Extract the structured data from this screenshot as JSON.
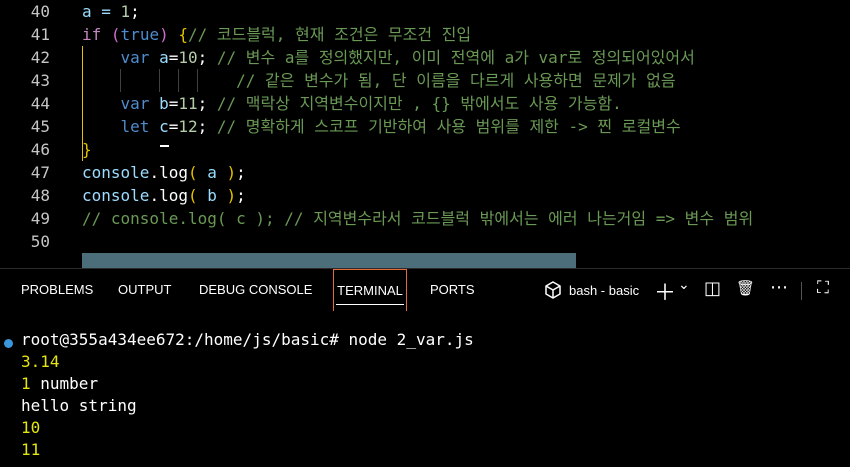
{
  "editor": {
    "lines": [
      {
        "num": "40",
        "parts": [
          {
            "t": "a = ",
            "c": "ident"
          },
          {
            "t": "1",
            "c": "num"
          },
          {
            "t": ";",
            "c": "plain"
          }
        ]
      },
      {
        "num": "41",
        "parts": [
          {
            "t": "if ",
            "c": "kw2"
          },
          {
            "t": "(",
            "c": "paren"
          },
          {
            "t": "true",
            "c": "bool"
          },
          {
            "t": ")",
            "c": "paren"
          },
          {
            "t": " {",
            "c": "brace"
          },
          {
            "t": "// 코드블럭, 현재 조건은 무조건 진입",
            "c": "cm"
          }
        ]
      },
      {
        "num": "42",
        "parts": [
          {
            "t": "    var ",
            "c": "kw"
          },
          {
            "t": "a",
            "c": "var"
          },
          {
            "t": "=",
            "c": "plain"
          },
          {
            "t": "10",
            "c": "num"
          },
          {
            "t": "; ",
            "c": "plain"
          },
          {
            "t": "// 변수 a를 정의했지만, 이미 전역에 a가 var로 정의되어있어서",
            "c": "cm"
          }
        ]
      },
      {
        "num": "43",
        "parts": [
          {
            "t": "                ",
            "c": "plain"
          },
          {
            "t": "// 같은 변수가 됨, 단 이름을 다르게 사용하면 문제가 없음",
            "c": "cm"
          }
        ]
      },
      {
        "num": "44",
        "parts": [
          {
            "t": "    var ",
            "c": "kw"
          },
          {
            "t": "b",
            "c": "var"
          },
          {
            "t": "=",
            "c": "plain"
          },
          {
            "t": "11",
            "c": "num"
          },
          {
            "t": "; ",
            "c": "plain"
          },
          {
            "t": "// 맥락상 지역변수이지만 , {} 밖에서도 사용 가능함.",
            "c": "cm"
          }
        ]
      },
      {
        "num": "45",
        "parts": [
          {
            "t": "    let ",
            "c": "kw"
          },
          {
            "t": "c",
            "c": "var"
          },
          {
            "t": "=",
            "c": "plain"
          },
          {
            "t": "12",
            "c": "num"
          },
          {
            "t": "; ",
            "c": "plain"
          },
          {
            "t": "// 명확하게 스코프 기반하여 사용 범위를 제한 -> 찐 로컬변수",
            "c": "cm"
          }
        ]
      },
      {
        "num": "46",
        "parts": [
          {
            "t": "}",
            "c": "brace"
          }
        ]
      },
      {
        "num": "47",
        "parts": [
          {
            "t": "console",
            "c": "ident"
          },
          {
            "t": ".",
            "c": "plain"
          },
          {
            "t": "log",
            "c": "plain"
          },
          {
            "t": "(",
            "c": "brace"
          },
          {
            "t": " a ",
            "c": "ident"
          },
          {
            "t": ")",
            "c": "brace"
          },
          {
            "t": ";",
            "c": "plain"
          }
        ]
      },
      {
        "num": "48",
        "parts": [
          {
            "t": "console",
            "c": "ident"
          },
          {
            "t": ".",
            "c": "plain"
          },
          {
            "t": "log",
            "c": "plain"
          },
          {
            "t": "(",
            "c": "brace"
          },
          {
            "t": " b ",
            "c": "ident"
          },
          {
            "t": ")",
            "c": "brace"
          },
          {
            "t": ";",
            "c": "plain"
          }
        ]
      },
      {
        "num": "49",
        "parts": [
          {
            "t": "// console.log( c ); // 지역변수라서 코드블럭 밖에서는 에러 나는거임 => 변수 범위",
            "c": "cm"
          }
        ]
      },
      {
        "num": "50",
        "parts": []
      }
    ]
  },
  "panel": {
    "tabs": [
      "PROBLEMS",
      "OUTPUT",
      "DEBUG CONSOLE",
      "TERMINAL",
      "PORTS"
    ],
    "active_tab": "TERMINAL",
    "terminal_name": "bash - basic",
    "icons": {
      "plus": "＋",
      "chevron": "⌄",
      "split": "◫",
      "trash": "🗑",
      "more": "⋯",
      "maximize": "⛶"
    }
  },
  "terminal": {
    "prompt": "root@355a434ee672:/home/js/basic# node 2_var.js",
    "output": [
      {
        "text": "3.14",
        "color": "yellow"
      },
      {
        "text": "1",
        "color": "yellow",
        "rest": " number"
      },
      {
        "text": "hello string",
        "color": "plain"
      },
      {
        "text": "10",
        "color": "yellow"
      },
      {
        "text": "11",
        "color": "yellow"
      }
    ]
  },
  "colors": {
    "accent": "#e36a3a",
    "comment": "#6a9955",
    "keyword": "#4f8ccf",
    "terminal_dot": "#3a96dd"
  }
}
